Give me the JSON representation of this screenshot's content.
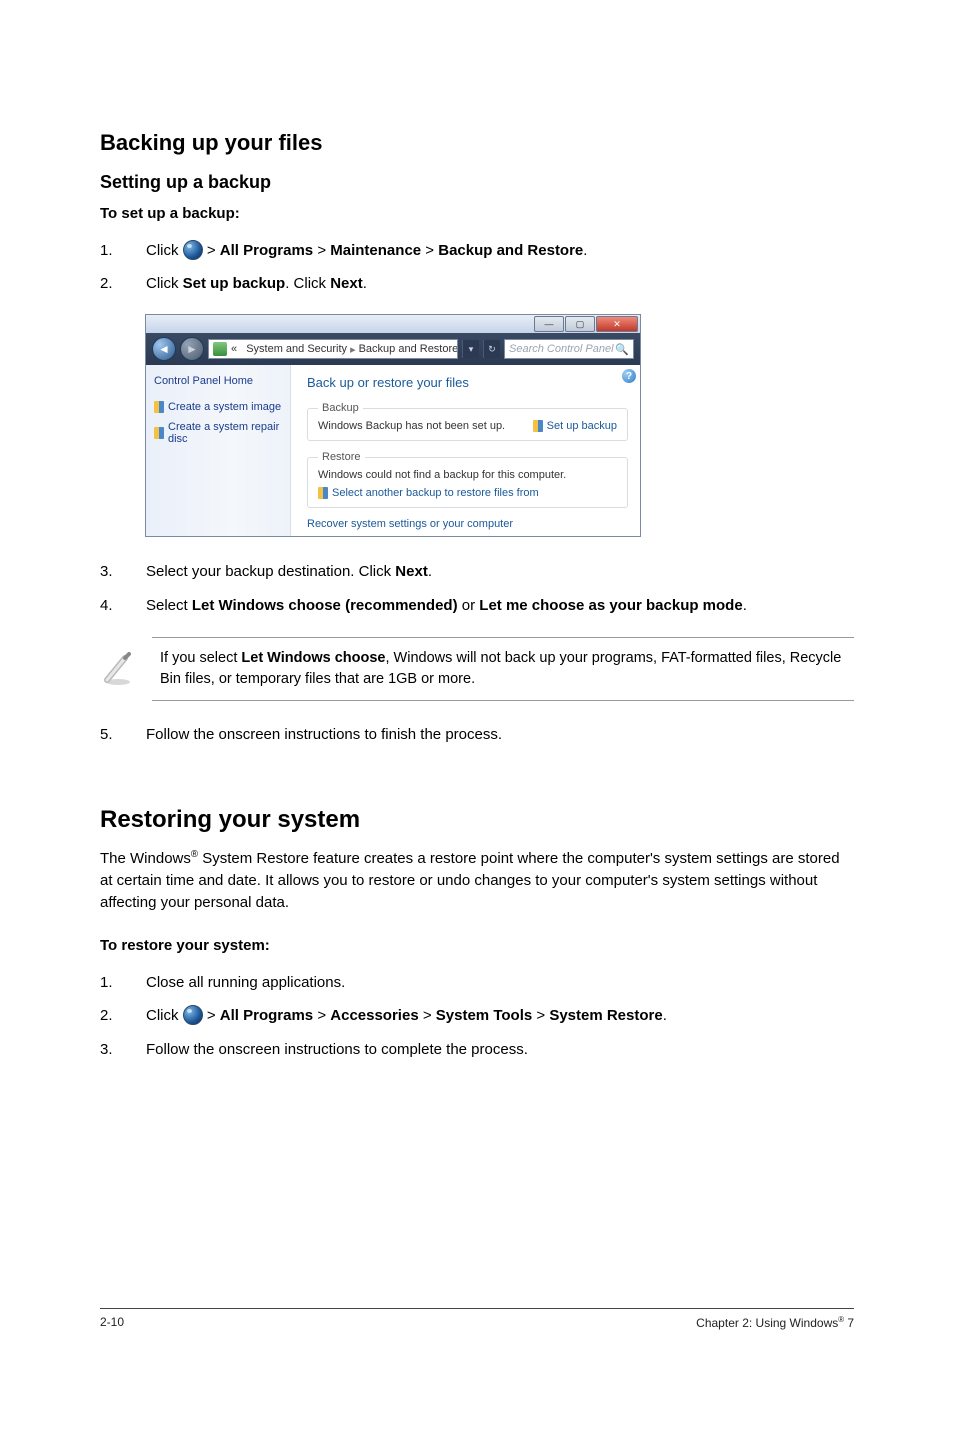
{
  "headings": {
    "h1": "Backing up your files",
    "h2": "Setting up a backup",
    "h3": "To set up a backup:",
    "restore_h1": "Restoring your system",
    "restore_h3": "To restore your system:"
  },
  "steps_backup": {
    "s1_pre": "Click ",
    "s1_post": " > All Programs > Maintenance > Backup and Restore.",
    "s2": "Click Set up backup. Click Next.",
    "s3": "Select your backup destination. Click Next.",
    "s4": "Select Let Windows choose (recommended) or Let me choose as your backup mode.",
    "s5": "Follow the onscreen instructions to finish the process."
  },
  "note": {
    "text": "If you select Let Windows choose, Windows will not back up your programs, FAT-formatted files, Recycle Bin files, or temporary files that are 1GB or more."
  },
  "restore_intro": "The Windows® System Restore feature creates a restore point where the computer's system settings are stored at certain time and date. It allows you to restore or undo changes to your computer's system settings without affecting your personal data.",
  "steps_restore": {
    "s1": "Close all running applications.",
    "s2_pre": "Click ",
    "s2_post": " > All Programs > Accessories > System Tools > System Restore.",
    "s3": "Follow the onscreen instructions to complete the process."
  },
  "window": {
    "breadcrumb_prefix": "«",
    "breadcrumb_1": "System and Security",
    "breadcrumb_2": "Backup and Restore",
    "search_placeholder": "Search Control Panel",
    "side_home": "Control Panel Home",
    "side_task1": "Create a system image",
    "side_task2": "Create a system repair disc",
    "pane_title": "Back up or restore your files",
    "grp_backup": "Backup",
    "backup_status": "Windows Backup has not been set up.",
    "setup_link": "Set up backup",
    "grp_restore": "Restore",
    "restore_status": "Windows could not find a backup for this computer.",
    "restore_link": "Select another backup to restore files from",
    "recover_link": "Recover system settings or your computer"
  },
  "footer": {
    "left": "2-10",
    "right": "Chapter 2: Using Windows® 7"
  }
}
